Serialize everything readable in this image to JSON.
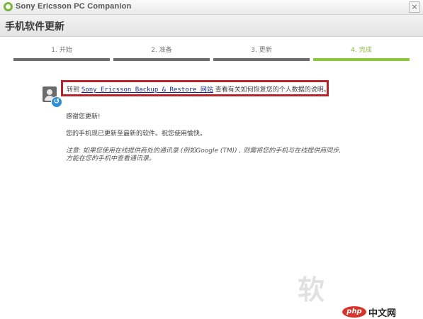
{
  "window": {
    "title": "Sony Ericsson PC Companion",
    "close_glyph": "×"
  },
  "header": {
    "title": "手机软件更新"
  },
  "steps": [
    {
      "label": "1. 开始",
      "state": "completed"
    },
    {
      "label": "2. 准备",
      "state": "completed"
    },
    {
      "label": "3. 更新",
      "state": "completed"
    },
    {
      "label": "4. 完成",
      "state": "active"
    }
  ],
  "content": {
    "highlight": {
      "prefix": "转到",
      "link": "Sony Ericsson Backup & Restore 网站",
      "suffix": "查看有关如何恢复您的个人数据的说明。"
    },
    "thanks": "感谢您更新!",
    "updated": "您的手机现已更新至最新的软件。祝您使用愉快。",
    "note_line1": "注意: 如果您使用在线提供商处的通讯录 (例如Google (TM)) , 则需将您的手机与在线提供商同步,",
    "note_line2": "方能在您的手机中查看通讯录。"
  },
  "watermark": {
    "char": "软",
    "logo": "php",
    "site": "中文网"
  },
  "colors": {
    "accent_green": "#8cc63e",
    "highlight_red": "#b6232b",
    "link_blue": "#1a2a8a"
  },
  "icons": {
    "app": "sony-ericsson-logo-icon",
    "backup": "backup-restore-icon"
  }
}
